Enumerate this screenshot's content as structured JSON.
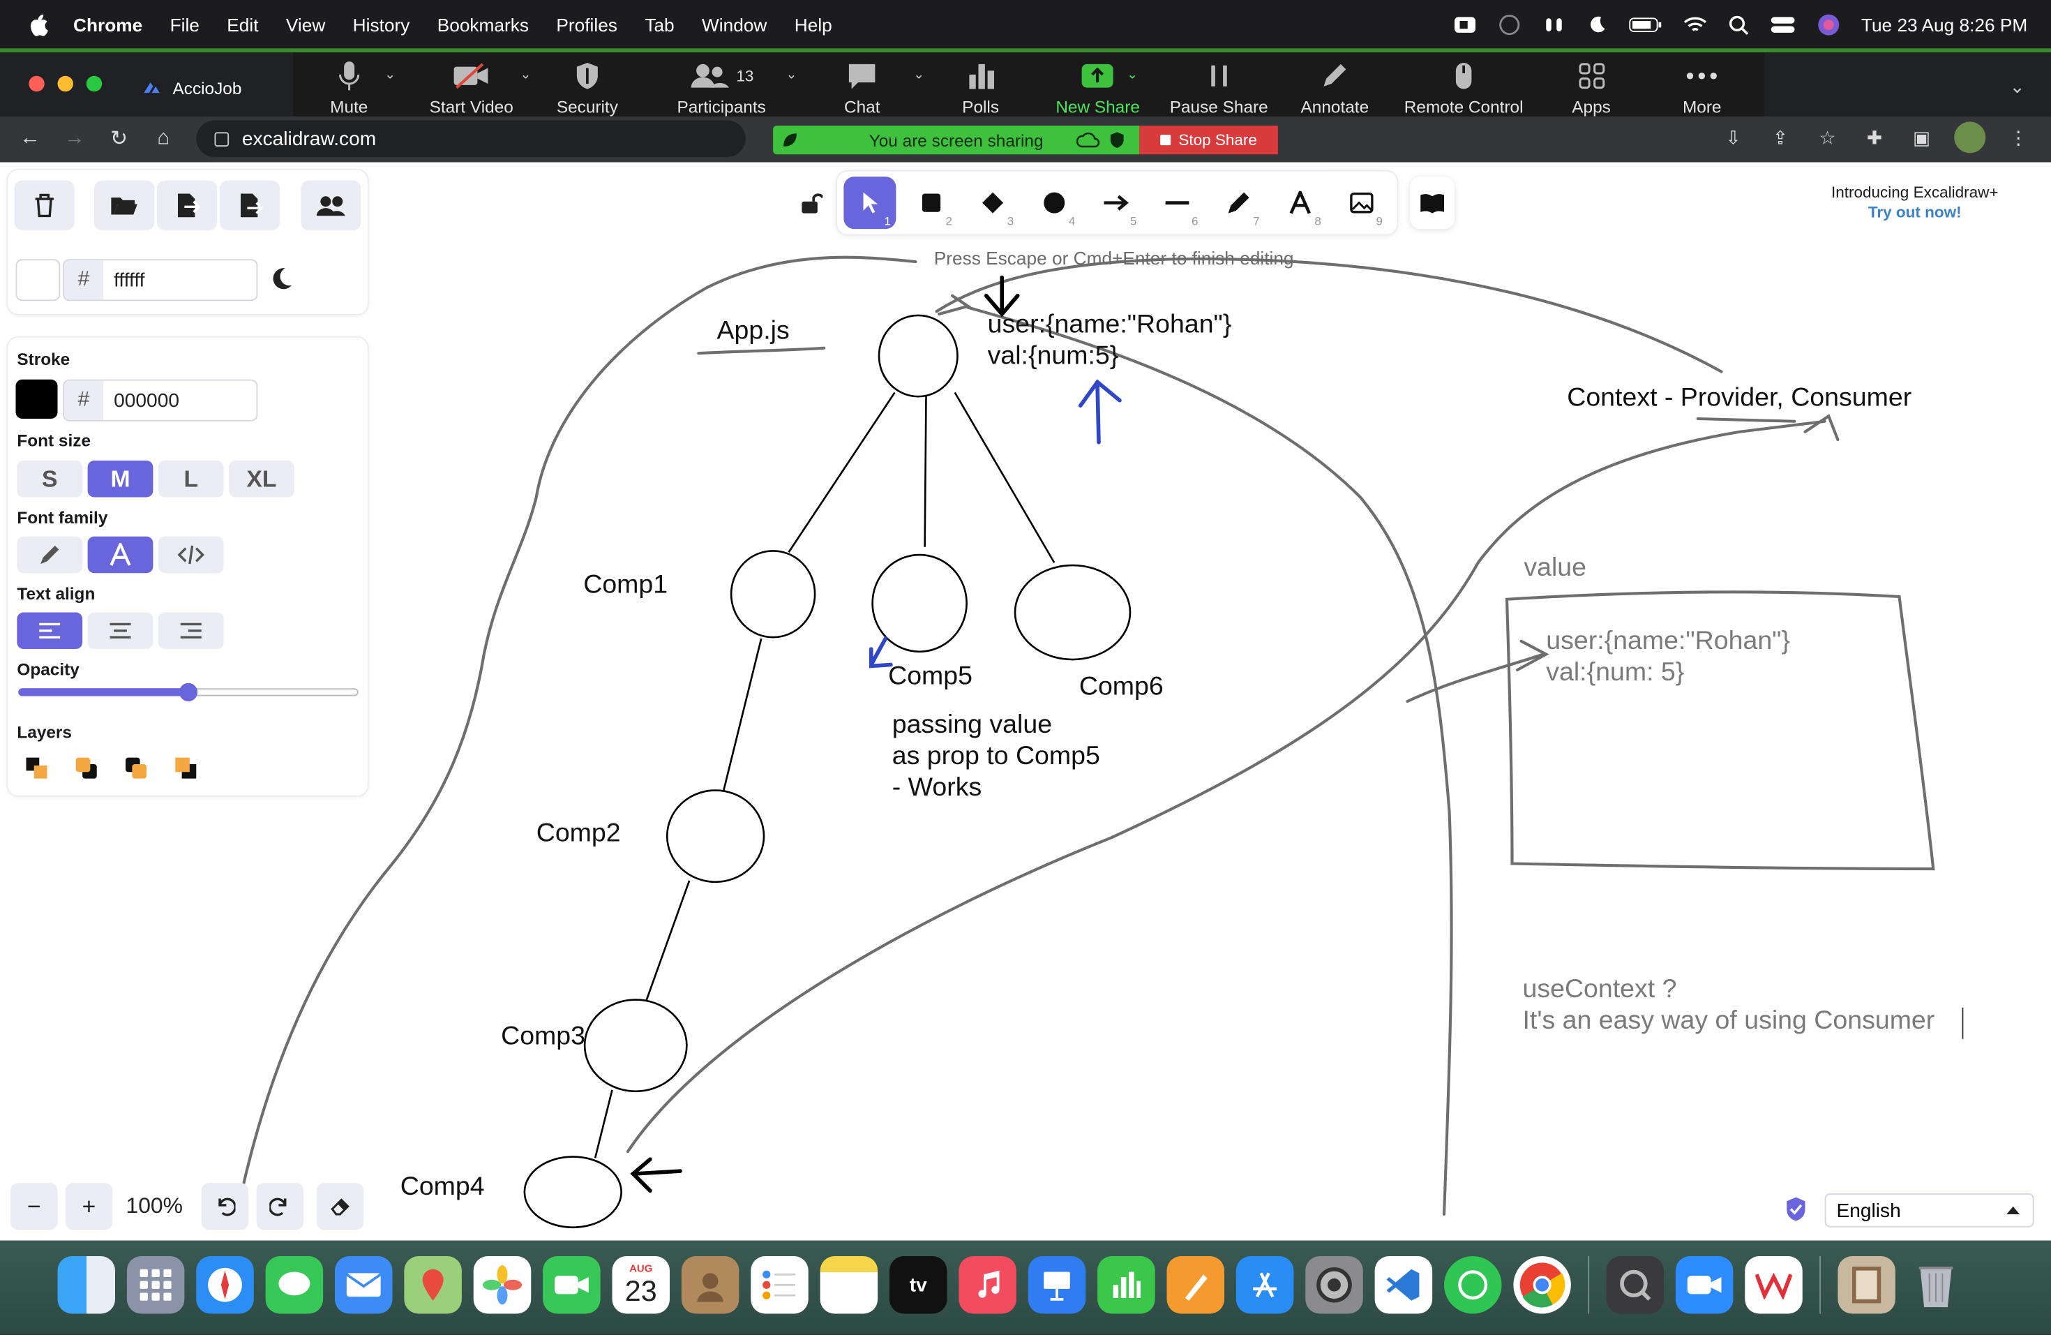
{
  "menubar": {
    "app": "Chrome",
    "items": [
      "File",
      "Edit",
      "View",
      "History",
      "Bookmarks",
      "Profiles",
      "Tab",
      "Window",
      "Help"
    ],
    "clock": "Tue 23 Aug  8:26 PM"
  },
  "browser": {
    "tab_title": "AccioJob",
    "url": "excalidraw.com"
  },
  "zoom": {
    "items": [
      {
        "label": "Mute",
        "icon": "microphone-icon"
      },
      {
        "label": "Start Video",
        "icon": "video-off-icon"
      },
      {
        "label": "Security",
        "icon": "shield-icon"
      },
      {
        "label": "Participants",
        "icon": "participants-icon",
        "count": "13"
      },
      {
        "label": "Chat",
        "icon": "chat-icon"
      },
      {
        "label": "Polls",
        "icon": "polls-icon"
      },
      {
        "label": "New Share",
        "icon": "share-icon"
      },
      {
        "label": "Pause Share",
        "icon": "pause-icon"
      },
      {
        "label": "Annotate",
        "icon": "pen-icon"
      },
      {
        "label": "Remote Control",
        "icon": "mouse-icon"
      },
      {
        "label": "Apps",
        "icon": "apps-icon"
      },
      {
        "label": "More",
        "icon": "more-icon"
      }
    ],
    "sharing_text": "You are screen sharing",
    "stop_label": "Stop Share"
  },
  "excalidraw": {
    "canvas_bg": "ffffff",
    "stroke_label": "Stroke",
    "stroke_color": "000000",
    "font_size_label": "Font size",
    "font_sizes": [
      "S",
      "M",
      "L",
      "XL"
    ],
    "font_family_label": "Font family",
    "text_align_label": "Text align",
    "opacity_label": "Opacity",
    "opacity_value": 0.5,
    "layers_label": "Layers",
    "hash": "#",
    "zoom_level": "100%",
    "edit_hint": "Press Escape or Cmd+Enter to finish editing",
    "promo_title": "Introducing Excalidraw+",
    "promo_link": "Try out now!",
    "language": "English",
    "tool_numbers": [
      "1",
      "2",
      "3",
      "4",
      "5",
      "6",
      "7",
      "8",
      "9"
    ],
    "accent": "#6965db"
  },
  "drawing": {
    "app_label": "App.js",
    "user_line": "user:{name:\"Rohan\"}",
    "val_line": "val:{num:5}",
    "context_label": "Context - Provider, Consumer",
    "comp1": "Comp1",
    "comp2": "Comp2",
    "comp3": "Comp3",
    "comp4": "Comp4",
    "comp5": "Comp5",
    "comp6": "Comp6",
    "note_lines": [
      "passing value",
      "as prop to Comp5",
      "- Works"
    ],
    "value_label": "value",
    "box_user": "user:{name:\"Rohan\"}",
    "box_val": "val:{num: 5}",
    "usecontext_q": "useContext ?",
    "usecontext_desc": "It's an easy way of using Consumer"
  },
  "dock": {
    "calendar_month": "AUG",
    "calendar_day": "23",
    "tv_label": "tv"
  }
}
